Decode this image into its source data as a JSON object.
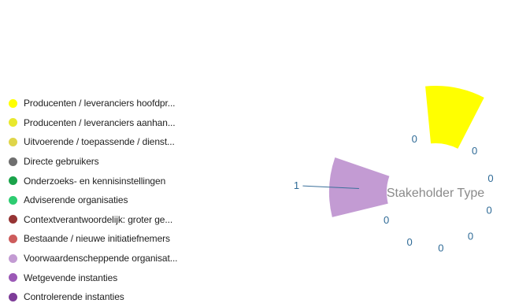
{
  "chart_data": {
    "type": "polar-area",
    "title": "Stakeholder Type",
    "max_value": 1,
    "categories": [
      "Producenten / leveranciers hoofdpr...",
      "Producenten / leveranciers aanhan...",
      "Uitvoerende / toepassende / dienst...",
      "Directe gebruikers",
      "Onderzoeks- en kennisinstellingen",
      "Adviserende organisaties",
      "Contextverantwoordelijk: groter ge...",
      "Bestaande / nieuwe initiatiefnemers",
      "Voorwaardenscheppende organisat...",
      "Wetgevende instanties",
      "Controlerende instanties"
    ],
    "values": [
      1,
      0,
      0,
      0,
      0,
      0,
      0,
      0,
      1,
      0,
      0
    ],
    "data_labels": [
      "",
      "0",
      "0",
      "0",
      "0",
      "0",
      "0",
      "0",
      "1",
      "",
      "0"
    ],
    "colors": [
      "#ffff00",
      "#e8e82e",
      "#dfd54a",
      "#6f6f6f",
      "#1aa34a",
      "#2ecc71",
      "#963434",
      "#cd5c5c",
      "#c39bd3",
      "#9b59b6",
      "#7d3c98"
    ],
    "legend_position": "left"
  }
}
